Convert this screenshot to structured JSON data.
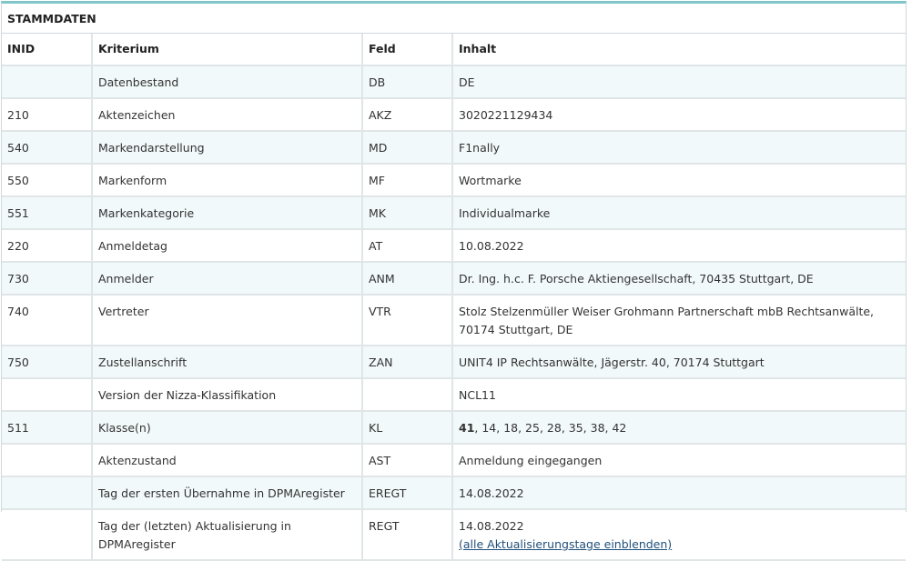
{
  "panel": {
    "title": "STAMMDATEN"
  },
  "columns": {
    "inid": "INID",
    "kriterium": "Kriterium",
    "feld": "Feld",
    "inhalt": "Inhalt"
  },
  "rows": [
    {
      "inid": "",
      "kriterium": "Datenbestand",
      "feld": "DB",
      "inhalt": "DE"
    },
    {
      "inid": "210",
      "kriterium": "Aktenzeichen",
      "feld": "AKZ",
      "inhalt": "3020221129434"
    },
    {
      "inid": "540",
      "kriterium": "Markendarstellung",
      "feld": "MD",
      "inhalt": "F1nally"
    },
    {
      "inid": "550",
      "kriterium": "Markenform",
      "feld": "MF",
      "inhalt": "Wortmarke"
    },
    {
      "inid": "551",
      "kriterium": "Markenkategorie",
      "feld": "MK",
      "inhalt": "Individualmarke"
    },
    {
      "inid": "220",
      "kriterium": "Anmeldetag",
      "feld": "AT",
      "inhalt": "10.08.2022"
    },
    {
      "inid": "730",
      "kriterium": "Anmelder",
      "feld": "ANM",
      "inhalt": "Dr. Ing. h.c. F. Porsche Aktiengesellschaft, 70435 Stuttgart, DE"
    },
    {
      "inid": "740",
      "kriterium": "Vertreter",
      "feld": "VTR",
      "inhalt": "Stolz Stelzenmüller Weiser Grohmann Partnerschaft mbB Rechtsanwälte, 70174 Stuttgart, DE"
    },
    {
      "inid": "750",
      "kriterium": "Zustellanschrift",
      "feld": "ZAN",
      "inhalt": "UNIT4 IP Rechtsanwälte, Jägerstr. 40, 70174 Stuttgart"
    },
    {
      "inid": "",
      "kriterium": "Version der Nizza-Klassifikation",
      "feld": "",
      "inhalt": "NCL11"
    },
    {
      "inid": "511",
      "kriterium": "Klasse(n)",
      "feld": "KL",
      "inhalt_bold": "41",
      "inhalt_rest": ", 14, 18, 25, 28, 35, 38, 42"
    },
    {
      "inid": "",
      "kriterium": "Aktenzustand",
      "feld": "AST",
      "inhalt": "Anmeldung eingegangen"
    },
    {
      "inid": "",
      "kriterium": "Tag der ersten Übernahme in DPMAregister",
      "feld": "EREGT",
      "inhalt": "14.08.2022"
    },
    {
      "inid": "",
      "kriterium": "Tag der (letzten) Aktualisierung in DPMAregister",
      "feld": "REGT",
      "inhalt": "14.08.2022",
      "link": "(alle Aktualisierungstage einblenden)"
    }
  ]
}
